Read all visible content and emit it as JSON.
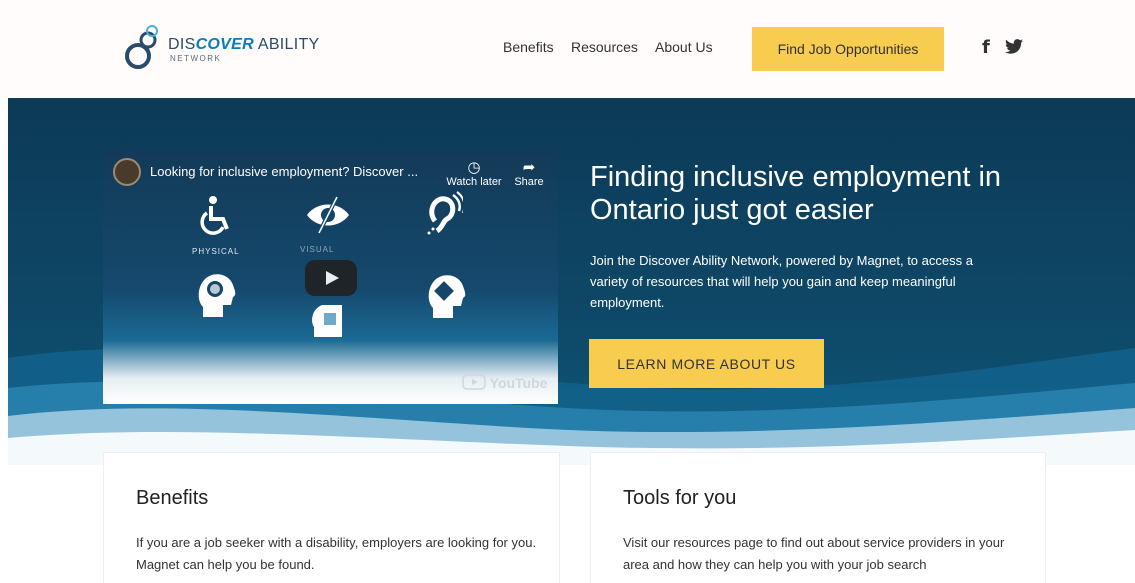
{
  "header": {
    "logo": {
      "dis": "DIS",
      "cover": "COVER",
      "ability": " ABILITY",
      "sub": "NETWORK"
    },
    "nav": [
      {
        "label": "Benefits"
      },
      {
        "label": "Resources"
      },
      {
        "label": "About Us"
      }
    ],
    "cta_label": "Find Job Opportunities",
    "social": {
      "facebook_icon": "f",
      "twitter_icon": "bird"
    }
  },
  "hero": {
    "video": {
      "title": "Looking for inclusive employment? Discover ...",
      "watch_later_label": "Watch later",
      "share_label": "Share",
      "categories": [
        "PHYSICAL",
        "VISUAL"
      ],
      "youtube_label": "YouTube"
    },
    "heading": "Finding inclusive employment in Ontario just got easier",
    "text": "Join the Discover Ability Network, powered by Magnet, to access a variety of resources that will help you gain and keep meaningful employment.",
    "button_label": "LEARN MORE ABOUT US"
  },
  "cards": [
    {
      "title": "Benefits",
      "text": "If you are a job seeker with a disability, employers are looking for you. Magnet can help you be found."
    },
    {
      "title": "Tools for you",
      "text": "Visit our resources page to find out about service providers in your area and how they can help you with your job search"
    }
  ],
  "colors": {
    "accent": "#f7cc4f",
    "hero_bg": "#0e4766",
    "header_bg": "#fffcfb"
  }
}
